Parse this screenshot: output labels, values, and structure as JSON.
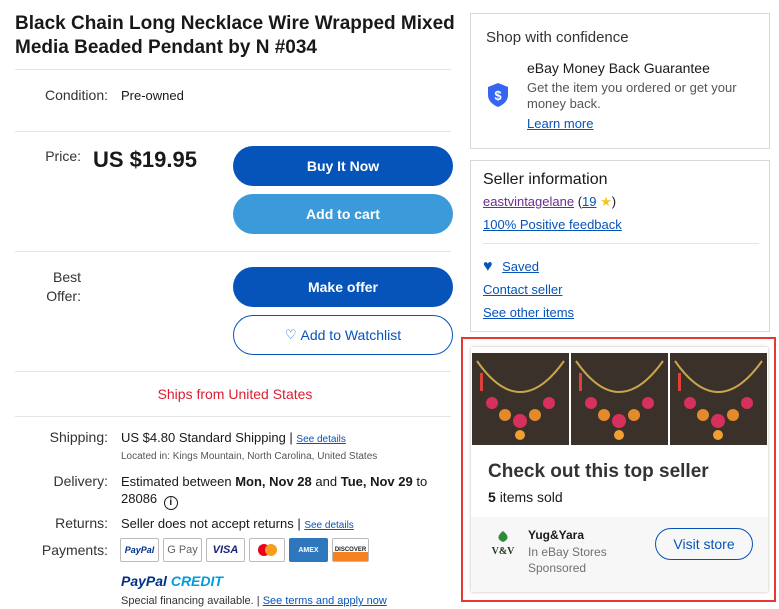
{
  "item": {
    "title": "Black Chain Long Necklace Wire Wrapped Mixed Media Beaded Pendant by N #034",
    "condition_label": "Condition:",
    "condition_value": "Pre-owned",
    "price_label": "Price:",
    "price_value": "US $19.95",
    "best_offer_label_1": "Best",
    "best_offer_label_2": "Offer:"
  },
  "actions": {
    "buy_now": "Buy It Now",
    "add_to_cart": "Add to cart",
    "make_offer": "Make offer",
    "add_to_watchlist": "Add to Watchlist"
  },
  "ships_from": "Ships from United States",
  "shipping": {
    "label": "Shipping:",
    "cost": "US $4.80",
    "method": "Standard Shipping |",
    "details_link": "See details",
    "location": "Located in: Kings Mountain, North Carolina, United States"
  },
  "delivery": {
    "label": "Delivery:",
    "prefix": "Estimated between",
    "range": "Mon, Nov 28",
    "and": "and",
    "end": "Tue, Nov 29",
    "to": "to",
    "zip": "28086"
  },
  "returns": {
    "label": "Returns:",
    "text": "Seller does not accept returns |",
    "details_link": "See details"
  },
  "payments": {
    "label": "Payments:",
    "methods": [
      "PayPal",
      "G Pay",
      "VISA",
      "Mastercard",
      "AMEX",
      "DISCOVER"
    ],
    "paypal_credit_1": "PayPal",
    "paypal_credit_2": "CREDIT",
    "financing_text": "Special financing available. |",
    "financing_link": "See terms and apply now"
  },
  "confidence": {
    "heading": "Shop with confidence",
    "guarantee_title": "eBay Money Back Guarantee",
    "guarantee_text": "Get the item you ordered or get your money back.",
    "learn_more": "Learn more"
  },
  "seller": {
    "heading": "Seller information",
    "name": "eastvintagelane",
    "feedback_count": "19",
    "feedback_open": "(",
    "feedback_close": ")",
    "positive": "100% Positive feedback",
    "saved": "Saved",
    "contact": "Contact seller",
    "other_items": "See other items"
  },
  "ad": {
    "heading": "Check out this top seller",
    "sold_count": "5",
    "sold_text": "items sold",
    "store_name": "Yug&Yara",
    "store_sub": "In eBay Stores",
    "sponsored": "Sponsored",
    "visit": "Visit store"
  },
  "colors": {
    "primary_blue": "#0654ba",
    "light_blue": "#3b9ad9",
    "ships_red": "#dd1e31",
    "highlight_red": "#e53935"
  }
}
